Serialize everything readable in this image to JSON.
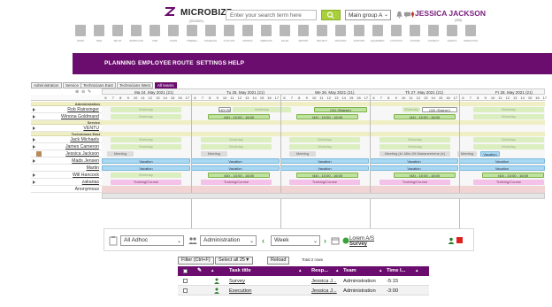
{
  "app": {
    "brand": "MICROBIZZ",
    "version": "(2010021)"
  },
  "search": {
    "placeholder": "Enter your search term here"
  },
  "group_select": {
    "value": "Main group A"
  },
  "user": {
    "name": "JESSICA JACKSON",
    "sub": "(308)"
  },
  "toolbar": [
    {
      "label": "START",
      "icon": "home-icon"
    },
    {
      "label": "SAMI",
      "icon": "face-icon"
    },
    {
      "label": "SETUP",
      "icon": "cogs-icon"
    },
    {
      "label": "WORKFLOW",
      "icon": "workflow-icon"
    },
    {
      "label": "CRM",
      "icon": "grid-icon"
    },
    {
      "label": "TASKS",
      "icon": "tasks-icon"
    },
    {
      "label": "TIMEREG",
      "icon": "clock-icon"
    },
    {
      "label": "SCHEDULE",
      "icon": "calendar-icon"
    },
    {
      "label": "OUTLOOK",
      "icon": "inbox-icon"
    },
    {
      "label": "PERSON",
      "icon": "person-icon"
    },
    {
      "label": "WEBSHOP",
      "icon": "building-icon"
    },
    {
      "label": "SALES",
      "icon": "handshake-icon"
    },
    {
      "label": "REPORT",
      "icon": "chart-icon"
    },
    {
      "label": "PROJECT",
      "icon": "list-icon"
    },
    {
      "label": "PROCESS",
      "icon": "refresh-icon"
    },
    {
      "label": "SUPPORT",
      "icon": "tools-icon"
    },
    {
      "label": "EQUIPMENT",
      "icon": "wrench-icon"
    },
    {
      "label": "LOGISTICS",
      "icon": "cross-icon"
    },
    {
      "label": "COURSE",
      "icon": "course-icon"
    },
    {
      "label": "CONNECT",
      "icon": "connect-icon"
    },
    {
      "label": "AGENTS",
      "icon": "car-icon"
    },
    {
      "label": "INSPECTION",
      "icon": "magnifier-icon"
    }
  ],
  "nav": [
    "PLANNING",
    "EMPLOYEE",
    "ROUTE",
    "SETTINGS",
    "HELP"
  ],
  "schedule": {
    "tabs": [
      {
        "label": "Administration",
        "active": false
      },
      {
        "label": "Service",
        "active": false
      },
      {
        "label": "Technicians East",
        "active": false
      },
      {
        "label": "Technicians West",
        "active": false
      },
      {
        "label": "All teams",
        "active": true
      }
    ],
    "days": [
      "Ma 24. May 2021 (21)",
      "Tu 25. May 2021 (21)",
      "We 26. May 2021 (21)",
      "Th 27. May 2021 (21)",
      "Fr 28. May 2021 (21)"
    ],
    "hours": [
      "6",
      "7",
      "8",
      "9",
      "10",
      "11",
      "12",
      "13",
      "14",
      "15",
      "16",
      "17"
    ],
    "sections": {
      "administration": "Administration",
      "service": "Service",
      "technicians_east": "Technicians East"
    },
    "rows": {
      "rob": "Rob Rainsinger",
      "winona": "Winona Goldmand",
      "ventu": "VENTU",
      "jack": "Jack Michaels",
      "james": "James Cameron",
      "jessica": "Jessica Jackson",
      "mads": "Mads Jensen",
      "martin": "Martin",
      "will": "Will Hancock",
      "zakarias": "zakarias",
      "anonymous": "Anonymous"
    },
    "labels": {
      "workday": "Workday",
      "shift": "(44) - 10:00 - 16:00",
      "vacation": "Vacation",
      "training": "Training/Course",
      "note_tue": "(40) Bla",
      "note_wed": "(41) (Ssterm)",
      "note_thu": "(40) (Ssterm)",
      "meeting": "Meeting",
      "meeting_long": "Meeting (kl. Mlm-09 Marianeeriene (e)",
      "vacation_short": "Vacation"
    }
  },
  "filter": {
    "type": "All Adhoc",
    "team": "Administration",
    "period": "Week",
    "lorem_1": "Lorem A/S",
    "lorem_2": "Survey"
  },
  "task_list": {
    "filter_btn": "Filter (Ctrl+F)",
    "select_all": "Select all",
    "page_size": "25▼",
    "reload": "Reload",
    "total": "Total 2 rows",
    "headers": {
      "title": "Task title",
      "resp": "Resp...",
      "team": "Team",
      "time": "Time I..."
    },
    "rows": [
      {
        "title": "Survey",
        "resp": "Jessica J...",
        "team": "Administration",
        "time": "-5:15"
      },
      {
        "title": "Execution",
        "resp": "Jessica J...",
        "team": "Administration",
        "time": "-3:00"
      }
    ]
  },
  "colors": {
    "brand": "#6b0d6e",
    "accent_green": "#a9cf3a",
    "vacation": "#a9d8f2",
    "training": "#f4c1e8",
    "workday": "#dbeec0"
  }
}
